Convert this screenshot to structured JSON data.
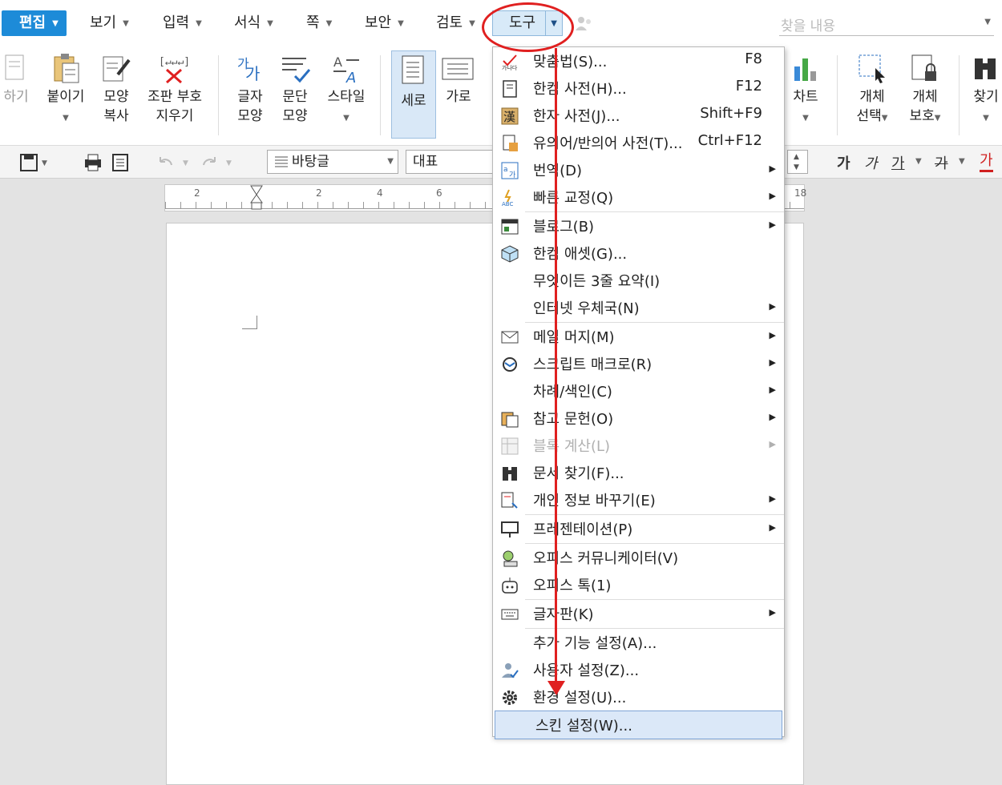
{
  "menubar": {
    "tabs": [
      "편집",
      "보기",
      "입력",
      "서식",
      "쪽",
      "보안",
      "검토",
      "도구"
    ],
    "search_placeholder": "찾을 내용"
  },
  "ribbon": {
    "items": [
      {
        "label": "하기"
      },
      {
        "label": "붙이기"
      },
      {
        "label": "모양",
        "label2": "복사"
      },
      {
        "label": "조판 부호",
        "label2": "지우기"
      },
      {
        "label": "글자",
        "label2": "모양"
      },
      {
        "label": "문단",
        "label2": "모양"
      },
      {
        "label": "스타일"
      },
      {
        "label": "세로"
      },
      {
        "label": "가로"
      },
      {
        "label": "차트"
      },
      {
        "label": "개체",
        "label2": "선택"
      },
      {
        "label": "개체",
        "label2": "보호"
      },
      {
        "label": "찾기"
      }
    ]
  },
  "toolbar": {
    "style_value": "바탕글",
    "font_value": "대표",
    "format_glyphs": [
      "가",
      "가",
      "가",
      "가",
      "가"
    ]
  },
  "ruler": {
    "numbers": [
      "2",
      "2",
      "4",
      "6",
      "18"
    ]
  },
  "tools_menu": {
    "items": [
      {
        "label": "맞춤법(S)...",
        "shortcut": "F8",
        "icon": "spellcheck-icon"
      },
      {
        "label": "한컴 사전(H)...",
        "shortcut": "F12",
        "icon": "dictionary-icon"
      },
      {
        "label": "한자 사전(J)...",
        "shortcut": "Shift+F9",
        "icon": "hanja-icon"
      },
      {
        "label": "유의어/반의어 사전(T)...",
        "shortcut": "Ctrl+F12",
        "icon": "thesaurus-icon"
      },
      {
        "label": "번역(D)",
        "icon": "translate-icon",
        "submenu": true
      },
      {
        "label": "빠른 교정(Q)",
        "icon": "quick-correct-icon",
        "submenu": true
      },
      {
        "label": "블로그(B)",
        "icon": "blog-icon",
        "submenu": true,
        "sep": true
      },
      {
        "label": "한컴 애셋(G)...",
        "icon": "asset-cube-icon"
      },
      {
        "label": "무엇이든 3줄 요약(I)"
      },
      {
        "label": "인터넷 우체국(N)",
        "submenu": true
      },
      {
        "label": "메일 머지(M)",
        "icon": "mail-icon",
        "submenu": true,
        "sep": true
      },
      {
        "label": "스크립트 매크로(R)",
        "icon": "macro-icon",
        "submenu": true
      },
      {
        "label": "차례/색인(C)",
        "submenu": true
      },
      {
        "label": "참고 문헌(O)",
        "icon": "bibliography-icon",
        "submenu": true
      },
      {
        "label": "블록 계산(L)",
        "icon": "block-calc-icon",
        "submenu": true,
        "disabled": true
      },
      {
        "label": "문서 찾기(F)...",
        "icon": "binoculars-icon"
      },
      {
        "label": "개인 정보 바꾸기(E)",
        "icon": "privacy-icon",
        "submenu": true
      },
      {
        "label": "프레젠테이션(P)",
        "icon": "presentation-icon",
        "submenu": true,
        "sep": true
      },
      {
        "label": "오피스 커뮤니케이터(V)",
        "icon": "communicator-icon",
        "sep": true
      },
      {
        "label": "오피스 톡(1)",
        "icon": "office-talk-icon"
      },
      {
        "label": "글자판(K)",
        "icon": "keyboard-icon",
        "submenu": true,
        "sep": true
      },
      {
        "label": "추가 기능 설정(A)...",
        "sep": true
      },
      {
        "label": "사용자 설정(Z)...",
        "icon": "user-settings-icon"
      },
      {
        "label": "환경 설정(U)...",
        "icon": "gear-icon"
      },
      {
        "label": "스킨 설정(W)...",
        "highlighted": true
      }
    ]
  }
}
